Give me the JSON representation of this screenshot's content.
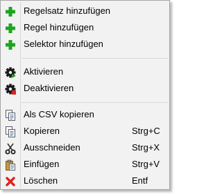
{
  "menu": {
    "groups": [
      {
        "items": [
          {
            "label": "Regelsatz hinzufügen",
            "icon": "green-plus-icon"
          },
          {
            "label": "Regel hinzufügen",
            "icon": "green-plus-icon"
          },
          {
            "label": "Selektor hinzufügen",
            "icon": "green-plus-icon"
          }
        ]
      },
      {
        "items": [
          {
            "label": "Aktivieren",
            "icon": "gear-activate-icon"
          },
          {
            "label": "Deaktivieren",
            "icon": "gear-deactivate-icon"
          }
        ]
      },
      {
        "items": [
          {
            "label": "Als CSV kopieren",
            "icon": "copy-icon"
          },
          {
            "label": "Kopieren",
            "shortcut": "Strg+C",
            "icon": "copy-icon"
          },
          {
            "label": "Ausschneiden",
            "shortcut": "Strg+X",
            "icon": "scissors-icon"
          },
          {
            "label": "Einfügen",
            "shortcut": "Strg+V",
            "icon": "paste-icon"
          },
          {
            "label": "Löschen",
            "shortcut": "Entf",
            "icon": "red-x-icon"
          }
        ]
      }
    ]
  },
  "colors": {
    "menu_background": "#f2f2f2",
    "plus_green": "#1ea51e",
    "delete_red": "#e02020"
  }
}
